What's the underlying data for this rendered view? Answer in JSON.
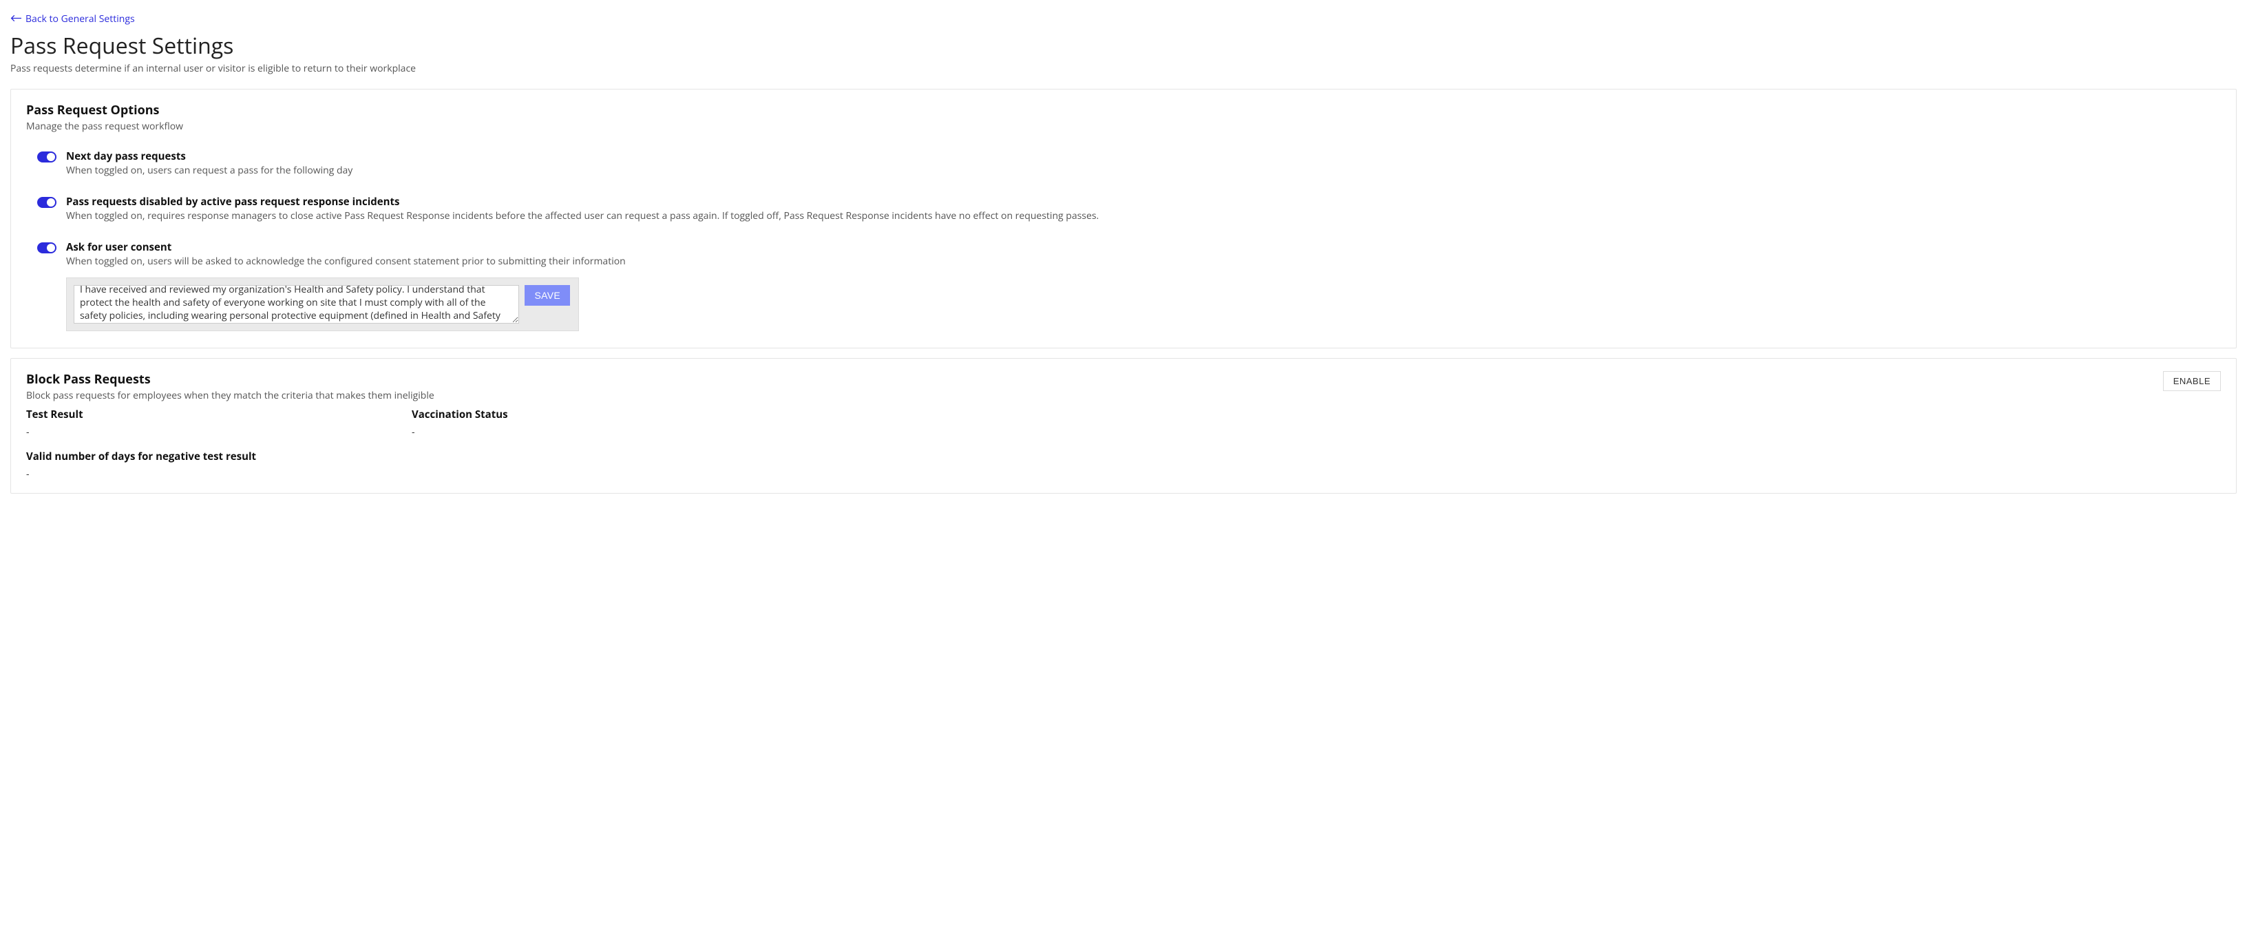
{
  "back_link_label": "Back to General Settings",
  "page_title": "Pass Request Settings",
  "page_subtitle": "Pass requests determine if an internal user or visitor is eligible to return to their workplace",
  "options_card": {
    "title": "Pass Request Options",
    "subtitle": "Manage the pass request workflow",
    "opt1_title": "Next day pass requests",
    "opt1_desc": "When toggled on, users can request a pass for the following day",
    "opt2_title": "Pass requests disabled by active pass request response incidents",
    "opt2_desc": "When toggled on, requires response managers to close active Pass Request Response incidents before the affected user can request a pass again. If toggled off, Pass Request Response incidents have no effect on requesting passes.",
    "opt3_title": "Ask for user consent",
    "opt3_desc": "When toggled on, users will be asked to acknowledge the configured consent statement prior to submitting their information",
    "consent_text": "I have received and reviewed my organization's Health and Safety policy. I understand that protect the health and safety of everyone working on site that I must comply with all of the safety policies, including wearing personal protective equipment (defined in Health and Safety policy) at all times",
    "save_label": "SAVE"
  },
  "block_card": {
    "title": "Block Pass Requests",
    "subtitle": "Block pass requests for employees when they match the criteria that makes them ineligible",
    "enable_label": "ENABLE",
    "crit1_label": "Test Result",
    "crit1_value": "-",
    "crit2_label": "Vaccination Status",
    "crit2_value": "-",
    "crit3_label": "Valid number of days for negative test result",
    "crit3_value": "-"
  }
}
